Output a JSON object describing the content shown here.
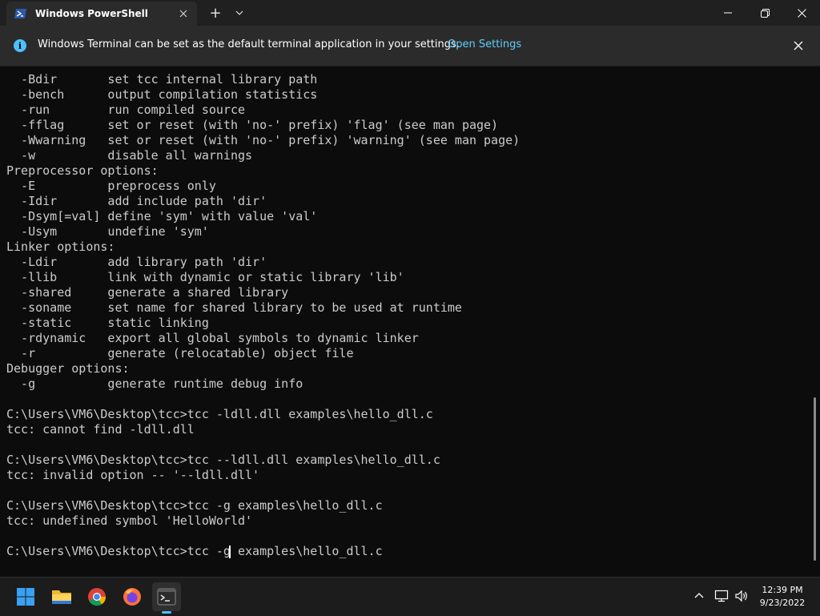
{
  "window": {
    "tab_title": "Windows PowerShell",
    "new_tab_symbol": "+",
    "icons": [
      "powershell-icon",
      "close-icon",
      "plus-icon",
      "chevron-down-icon",
      "minimize-icon",
      "maximize-icon",
      "close-icon"
    ]
  },
  "infobar": {
    "message": "Windows Terminal can be set as the default terminal application in your settings.",
    "link": "Open Settings",
    "info_symbol": "i"
  },
  "terminal": {
    "lines": [
      "  -Bdir       set tcc internal library path",
      "  -bench      output compilation statistics",
      "  -run        run compiled source",
      "  -fflag      set or reset (with 'no-' prefix) 'flag' (see man page)",
      "  -Wwarning   set or reset (with 'no-' prefix) 'warning' (see man page)",
      "  -w          disable all warnings",
      "Preprocessor options:",
      "  -E          preprocess only",
      "  -Idir       add include path 'dir'",
      "  -Dsym[=val] define 'sym' with value 'val'",
      "  -Usym       undefine 'sym'",
      "Linker options:",
      "  -Ldir       add library path 'dir'",
      "  -llib       link with dynamic or static library 'lib'",
      "  -shared     generate a shared library",
      "  -soname     set name for shared library to be used at runtime",
      "  -static     static linking",
      "  -rdynamic   export all global symbols to dynamic linker",
      "  -r          generate (relocatable) object file",
      "Debugger options:",
      "  -g          generate runtime debug info",
      "",
      "C:\\Users\\VM6\\Desktop\\tcc>tcc -ldll.dll examples\\hello_dll.c",
      "tcc: cannot find -ldll.dll",
      "",
      "C:\\Users\\VM6\\Desktop\\tcc>tcc --ldll.dll examples\\hello_dll.c",
      "tcc: invalid option -- '--ldll.dll'",
      "",
      "C:\\Users\\VM6\\Desktop\\tcc>tcc -g examples\\hello_dll.c",
      "tcc: undefined symbol 'HelloWorld'",
      "",
      "C:\\Users\\VM6\\Desktop\\tcc>tcc -g examples\\hello_dll.c"
    ]
  },
  "taskbar": {
    "apps": [
      "start-icon",
      "file-explorer-icon",
      "chrome-icon",
      "firefox-icon",
      "terminal-icon"
    ],
    "tray": [
      "chevron-up-icon",
      "network-icon",
      "volume-icon"
    ],
    "time": "12:39 PM",
    "date": "9/23/2022"
  },
  "colors": {
    "terminal_bg": "#0c0c0c",
    "terminal_text": "#cccccc",
    "accent": "#4cc2ff",
    "link": "#60cdff"
  }
}
